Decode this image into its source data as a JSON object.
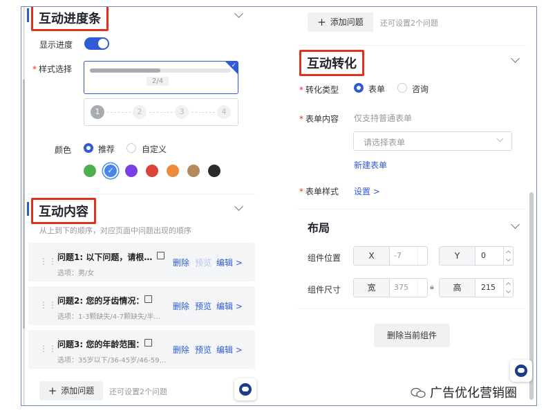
{
  "left": {
    "progress_section": {
      "title": "互动进度条",
      "show_progress_label": "显示进度",
      "show_progress_on": true,
      "style_label": "样式选择",
      "style_progress_text": "2/4",
      "steps": [
        "1",
        "2",
        "3",
        "4"
      ],
      "color_label": "颜色",
      "color_options": [
        "推荐",
        "自定义"
      ],
      "color_selected": "推荐",
      "swatches": [
        "#4caf50",
        "#4a86e8",
        "#7b3fe4",
        "#d9453a",
        "#ef8b3c",
        "#b58a5e",
        "#2b2b2b"
      ],
      "swatch_selected_index": 1
    },
    "content_section": {
      "title": "互动内容",
      "hint": "从上到下的顺序，对应页面中问题出现的顺序",
      "questions": [
        {
          "title": "问题1: 以下问题，请根…",
          "options": "选项：男/女",
          "actions": [
            "删除",
            "预览",
            "编辑 >"
          ],
          "preview_disabled": true
        },
        {
          "title": "问题2: 您的牙齿情况：",
          "options": "选项：1-3颗缺失/4-7颗缺失/半…",
          "actions": [
            "删除",
            "预览",
            "编辑 >"
          ],
          "preview_disabled": false
        },
        {
          "title": "问题3: 您的年龄范围：",
          "options": "选项：35岁以下/36-45岁/46-59…",
          "actions": [
            "删除",
            "预览",
            "编辑 >"
          ],
          "preview_disabled": false
        }
      ],
      "add_button": "添加问题",
      "add_hint": "还可设置2个问题"
    }
  },
  "right": {
    "top_add_button": "添加问题",
    "top_add_hint": "还可设置2个问题",
    "conversion_section": {
      "title": "互动转化",
      "type_label": "转化类型",
      "type_options": [
        "表单",
        "咨询"
      ],
      "type_selected": "表单",
      "form_content_label": "表单内容",
      "form_content_hint": "仅支持普通表单",
      "form_select_placeholder": "请选择表单",
      "new_form_link": "新建表单",
      "form_style_label": "表单样式",
      "form_style_link": "设置 >"
    },
    "layout_section": {
      "title": "布局",
      "position_label": "组件位置",
      "x_label": "X",
      "x_value": "-7",
      "y_label": "Y",
      "y_value": "0",
      "size_label": "组件尺寸",
      "width_label": "宽",
      "width_value": "375",
      "height_label": "高",
      "height_value": "215",
      "delete_button": "删除当前组件"
    }
  },
  "watermark": "广告优化营销圈",
  "colors": {
    "accent": "#2f5bd6",
    "annotation_red": "#e0311f"
  }
}
